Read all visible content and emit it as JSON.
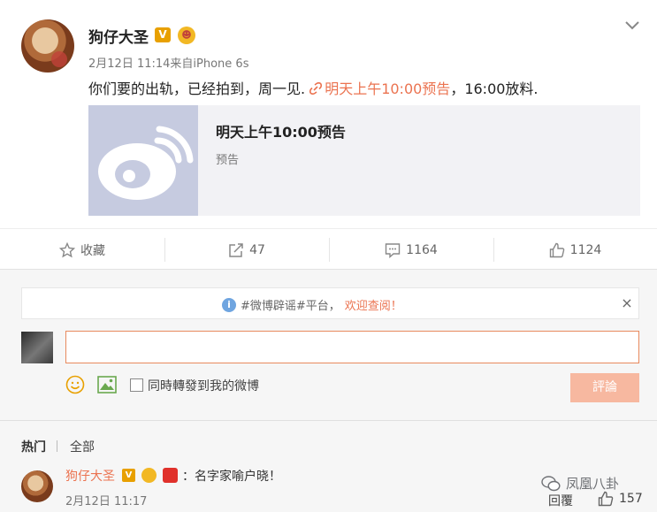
{
  "post": {
    "username": "狗仔大圣",
    "v_badge": "V",
    "meta": "2月12日 11:14来自iPhone 6s",
    "text_before": "你们要的出轨，已经拍到，周一见. ",
    "link_text": "明天上午10:00预告",
    "text_after": "，16:00放料.",
    "card": {
      "title": "明天上午10:00预告",
      "subtitle": "预告"
    }
  },
  "actions": {
    "favorite_label": "收藏",
    "repost_count": "47",
    "comment_count": "1164",
    "like_count": "1124"
  },
  "notice": {
    "text_prefix": "#微博辟谣#平台，",
    "text_link": "欢迎查阅！",
    "close": "×"
  },
  "compose": {
    "placeholder": "",
    "repost_label": "同時轉發到我的微博",
    "submit_label": "評論"
  },
  "sort": {
    "hot": "热门",
    "all": "全部"
  },
  "comment": {
    "author": "狗仔大圣",
    "v_badge": "V",
    "text": "：名字家喻户晓！",
    "time": "2月12日 11:17",
    "reply_label": "回覆",
    "like_count": "157"
  },
  "watermark": "凤凰八卦",
  "colors": {
    "accent": "#eb7350",
    "link_blue": "#6fa5e0",
    "submit_disabled": "#f7b8a0"
  }
}
